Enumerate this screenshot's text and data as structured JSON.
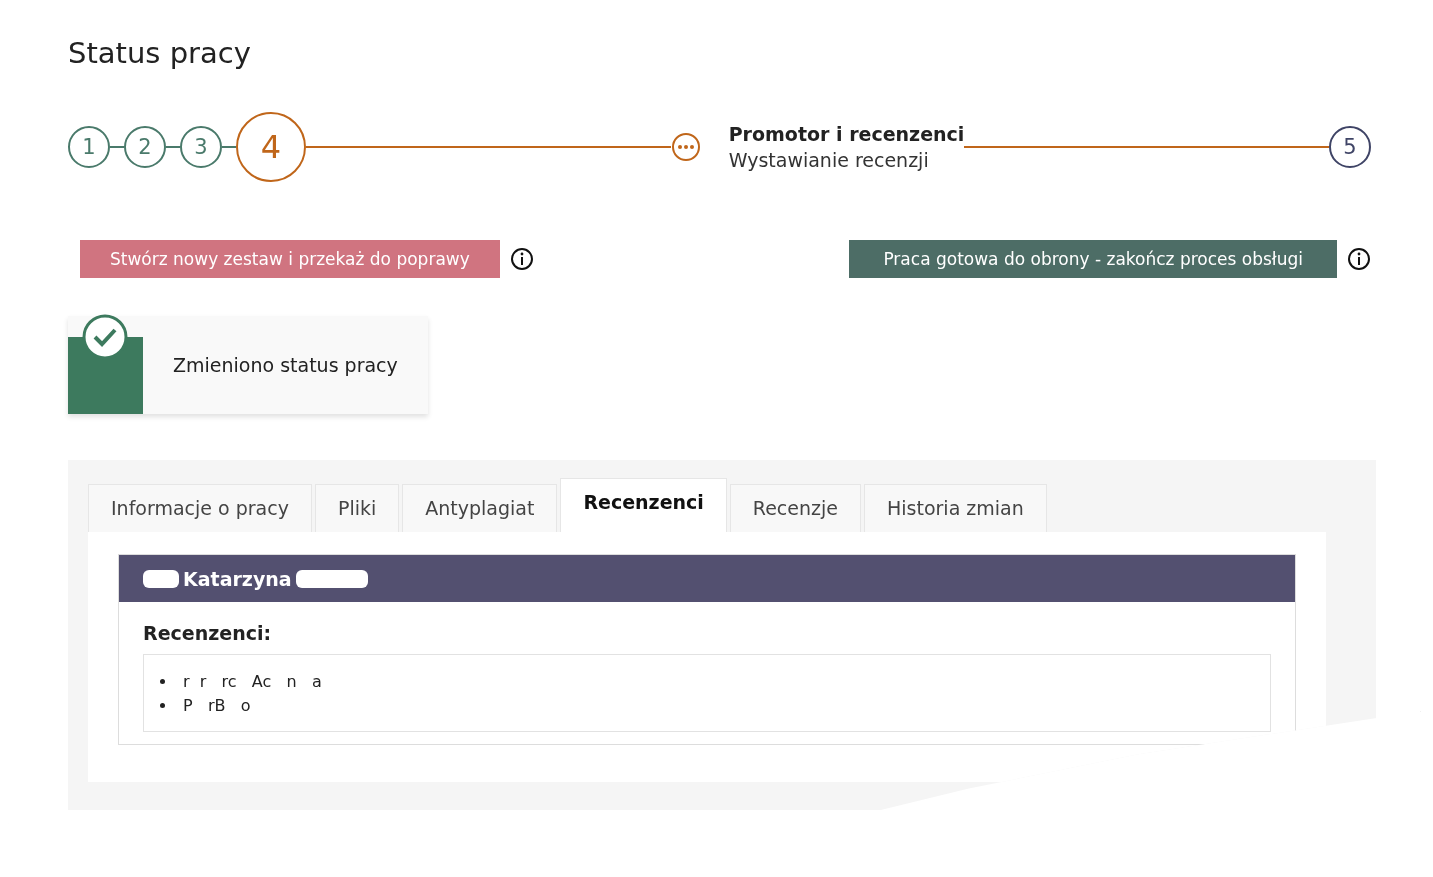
{
  "title": "Status pracy",
  "steps": [
    {
      "label": "1",
      "kind": "done"
    },
    {
      "label": "2",
      "kind": "done"
    },
    {
      "label": "3",
      "kind": "done"
    },
    {
      "label": "4",
      "kind": "current"
    }
  ],
  "substep": {
    "title": "Promotor i recenzenci",
    "subtitle": "Wystawianie recenzji"
  },
  "last_step": {
    "label": "5",
    "kind": "pending"
  },
  "actions": [
    {
      "label": "Stwórz nowy zestaw i przekaż do poprawy",
      "kind": "danger"
    },
    {
      "label": "Praca gotowa do obrony - zakończ proces obsługi",
      "kind": "success"
    }
  ],
  "notification": {
    "text": "Zmieniono status pracy"
  },
  "tabs": [
    {
      "label": "Informacje o pracy",
      "selected": false
    },
    {
      "label": "Pliki",
      "selected": false
    },
    {
      "label": "Antyplagiat",
      "selected": false
    },
    {
      "label": "Recenzenci",
      "selected": true
    },
    {
      "label": "Recenzje",
      "selected": false
    },
    {
      "label": "Historia zmian",
      "selected": false
    }
  ],
  "panel": {
    "header": "Katarzyna",
    "section_label": "Recenzenci:",
    "reviewers": [
      "r  r   rc   Ac   n   a",
      "P   rB   o"
    ]
  }
}
